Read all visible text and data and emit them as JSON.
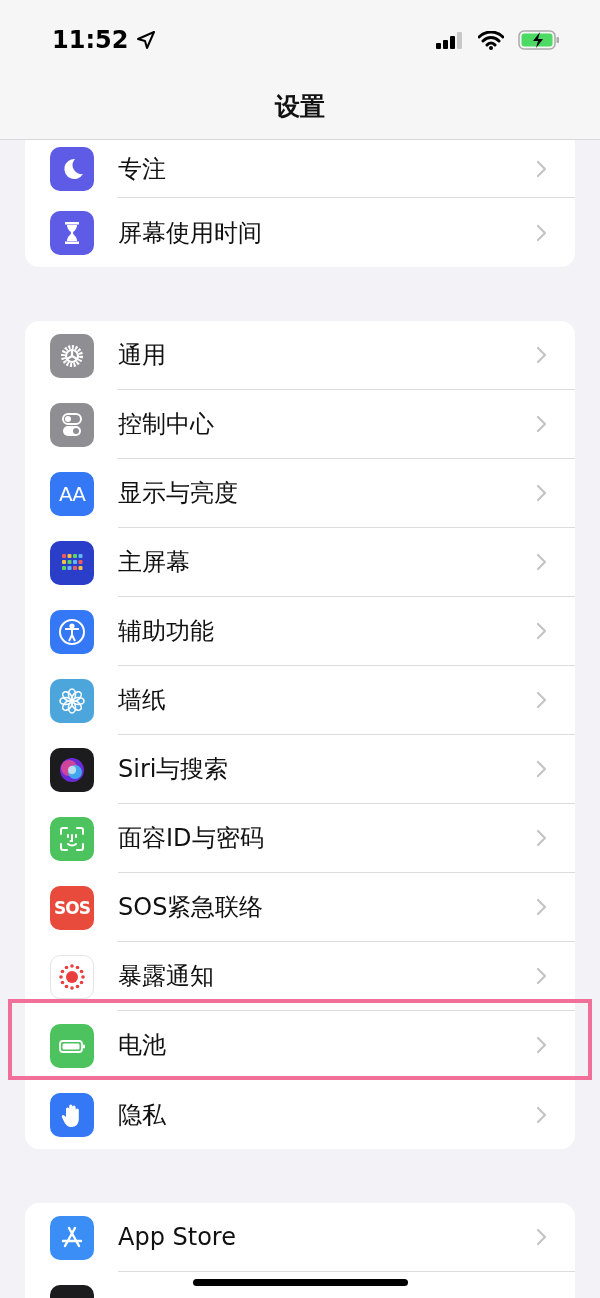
{
  "status_bar": {
    "time": "11:52"
  },
  "nav": {
    "title": "设置"
  },
  "groups": [
    {
      "items": [
        {
          "kind": "moon",
          "color": "#5e5ce6",
          "label": "专注",
          "highlighted": false
        },
        {
          "kind": "hourglass",
          "color": "#5e5ce6",
          "label": "屏幕使用时间",
          "highlighted": false
        }
      ]
    },
    {
      "items": [
        {
          "kind": "gear",
          "color": "#8e8e93",
          "label": "通用",
          "highlighted": false
        },
        {
          "kind": "toggles",
          "color": "#8e8e93",
          "label": "控制中心",
          "highlighted": false
        },
        {
          "kind": "text",
          "icon_text": "AA",
          "color": "#3478f6",
          "label": "显示与亮度",
          "highlighted": false
        },
        {
          "kind": "grid",
          "color": "#2a3ec9",
          "label": "主屏幕",
          "highlighted": false
        },
        {
          "kind": "person",
          "color": "#3478f6",
          "label": "辅助功能",
          "highlighted": false
        },
        {
          "kind": "flower",
          "color": "#4ca6dc",
          "label": "墙纸",
          "highlighted": false
        },
        {
          "kind": "orb",
          "color": "#1c1c1e",
          "label": "Siri与搜索",
          "highlighted": false
        },
        {
          "kind": "face",
          "color": "#4cc35e",
          "label": "面容ID与密码",
          "highlighted": false
        },
        {
          "kind": "text",
          "icon_text": "SOS",
          "color": "#e84a3c",
          "label": "SOS紧急联络",
          "highlighted": false
        },
        {
          "kind": "dots",
          "color": "#ffffff",
          "label": "暴露通知",
          "highlighted": false
        },
        {
          "kind": "battery",
          "color": "#4cc35e",
          "label": "电池",
          "highlighted": true
        },
        {
          "kind": "hand",
          "color": "#3478f6",
          "label": "隐私",
          "highlighted": false
        }
      ]
    },
    {
      "items": [
        {
          "kind": "appstore",
          "color": "#3a8ef5",
          "label": "App Store",
          "highlighted": false
        },
        {
          "kind": "blank",
          "color": "#1c1c1e"
        }
      ]
    }
  ]
}
